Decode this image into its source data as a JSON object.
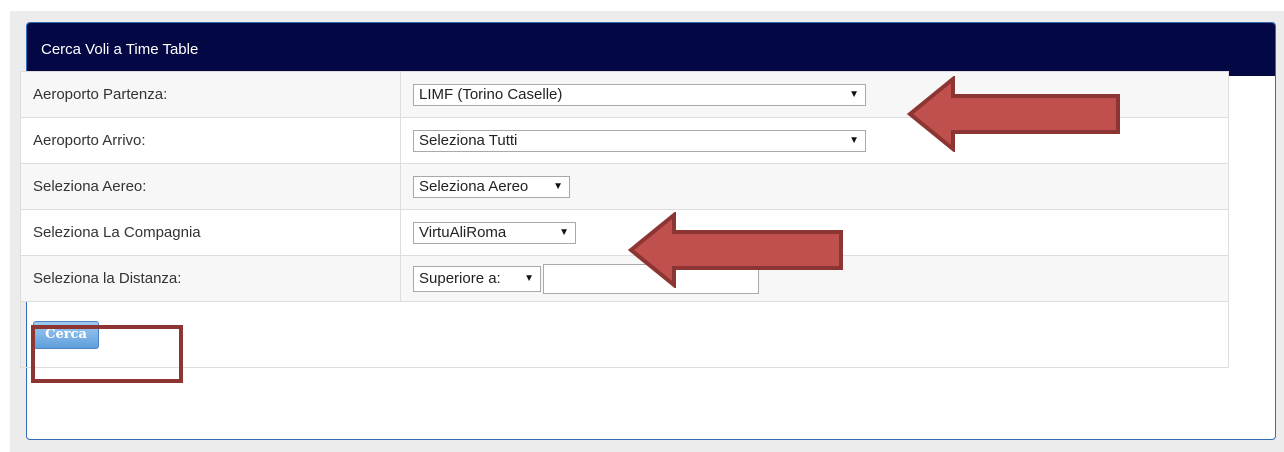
{
  "panel": {
    "title": "Cerca Voli a Time Table"
  },
  "form": {
    "rows": [
      {
        "label": "Aeroporto Partenza:",
        "value": "LIMF (Torino Caselle)"
      },
      {
        "label": "Aeroporto Arrivo:",
        "value": "Seleziona Tutti"
      },
      {
        "label": "Seleziona Aereo:",
        "value": "Seleziona Aereo"
      },
      {
        "label": "Seleziona La Compagnia",
        "value": "VirtuAliRoma"
      },
      {
        "label": "Seleziona la Distanza:",
        "value": "Superiore a:",
        "input_value": ""
      }
    ],
    "search_button": "Cerca"
  },
  "icons": {
    "dropdown": "dropdown-arrow-icon"
  },
  "colors": {
    "header_bg": "#030845",
    "annotation": "#c0504d",
    "button": "#6aa7e0"
  }
}
